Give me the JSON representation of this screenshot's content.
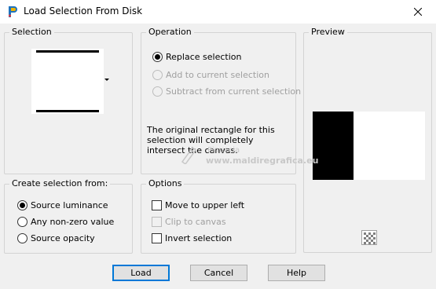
{
  "window": {
    "title": "Load Selection From Disk",
    "app_icon": "paint-shop-pro-icon",
    "close_icon": "close-icon"
  },
  "selection_group": {
    "label": "Selection",
    "dropdown_icon": "dropdown-arrow-icon"
  },
  "operation_group": {
    "label": "Operation",
    "options": [
      {
        "label": "Replace selection",
        "checked": true,
        "enabled": true
      },
      {
        "label": "Add to current selection",
        "checked": false,
        "enabled": false
      },
      {
        "label": "Subtract from current selection",
        "checked": false,
        "enabled": false
      }
    ],
    "info": "The original rectangle for this selection will completely intersect the canvas."
  },
  "preview_group": {
    "label": "Preview",
    "toggle_icon": "checkerboard-icon"
  },
  "create_group": {
    "label": "Create selection from:",
    "options": [
      {
        "label": "Source luminance",
        "checked": true
      },
      {
        "label": "Any non-zero value",
        "checked": false
      },
      {
        "label": "Source opacity",
        "checked": false
      }
    ]
  },
  "options_group": {
    "label": "Options",
    "items": [
      {
        "label": "Move to upper left",
        "checked": false,
        "enabled": true
      },
      {
        "label": "Clip to canvas",
        "checked": false,
        "enabled": false
      },
      {
        "label": "Invert selection",
        "checked": false,
        "enabled": true
      }
    ]
  },
  "watermark": {
    "line1": "Pinuccia",
    "line2": "www.maldiregrafica.eu"
  },
  "buttons": {
    "load": "Load",
    "cancel": "Cancel",
    "help": "Help"
  },
  "colors": {
    "accent": "#0078d7",
    "background": "#f0f0f0"
  }
}
